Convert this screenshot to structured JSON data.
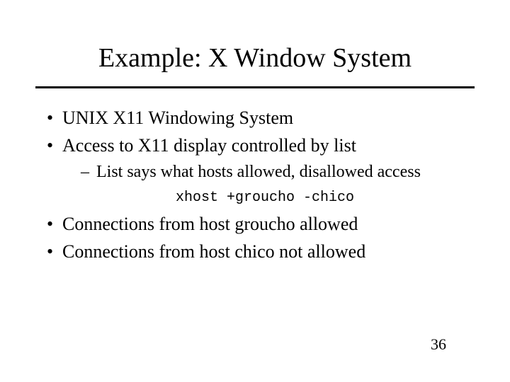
{
  "title": "Example: X Window System",
  "bullets_top": [
    "UNIX X11 Windowing System",
    "Access to X11 display controlled by list"
  ],
  "subbullet": "List says what hosts allowed, disallowed access",
  "code": "xhost +groucho -chico",
  "bullets_bottom": [
    "Connections from host groucho allowed",
    "Connections from host chico not allowed"
  ],
  "page_number": "36"
}
